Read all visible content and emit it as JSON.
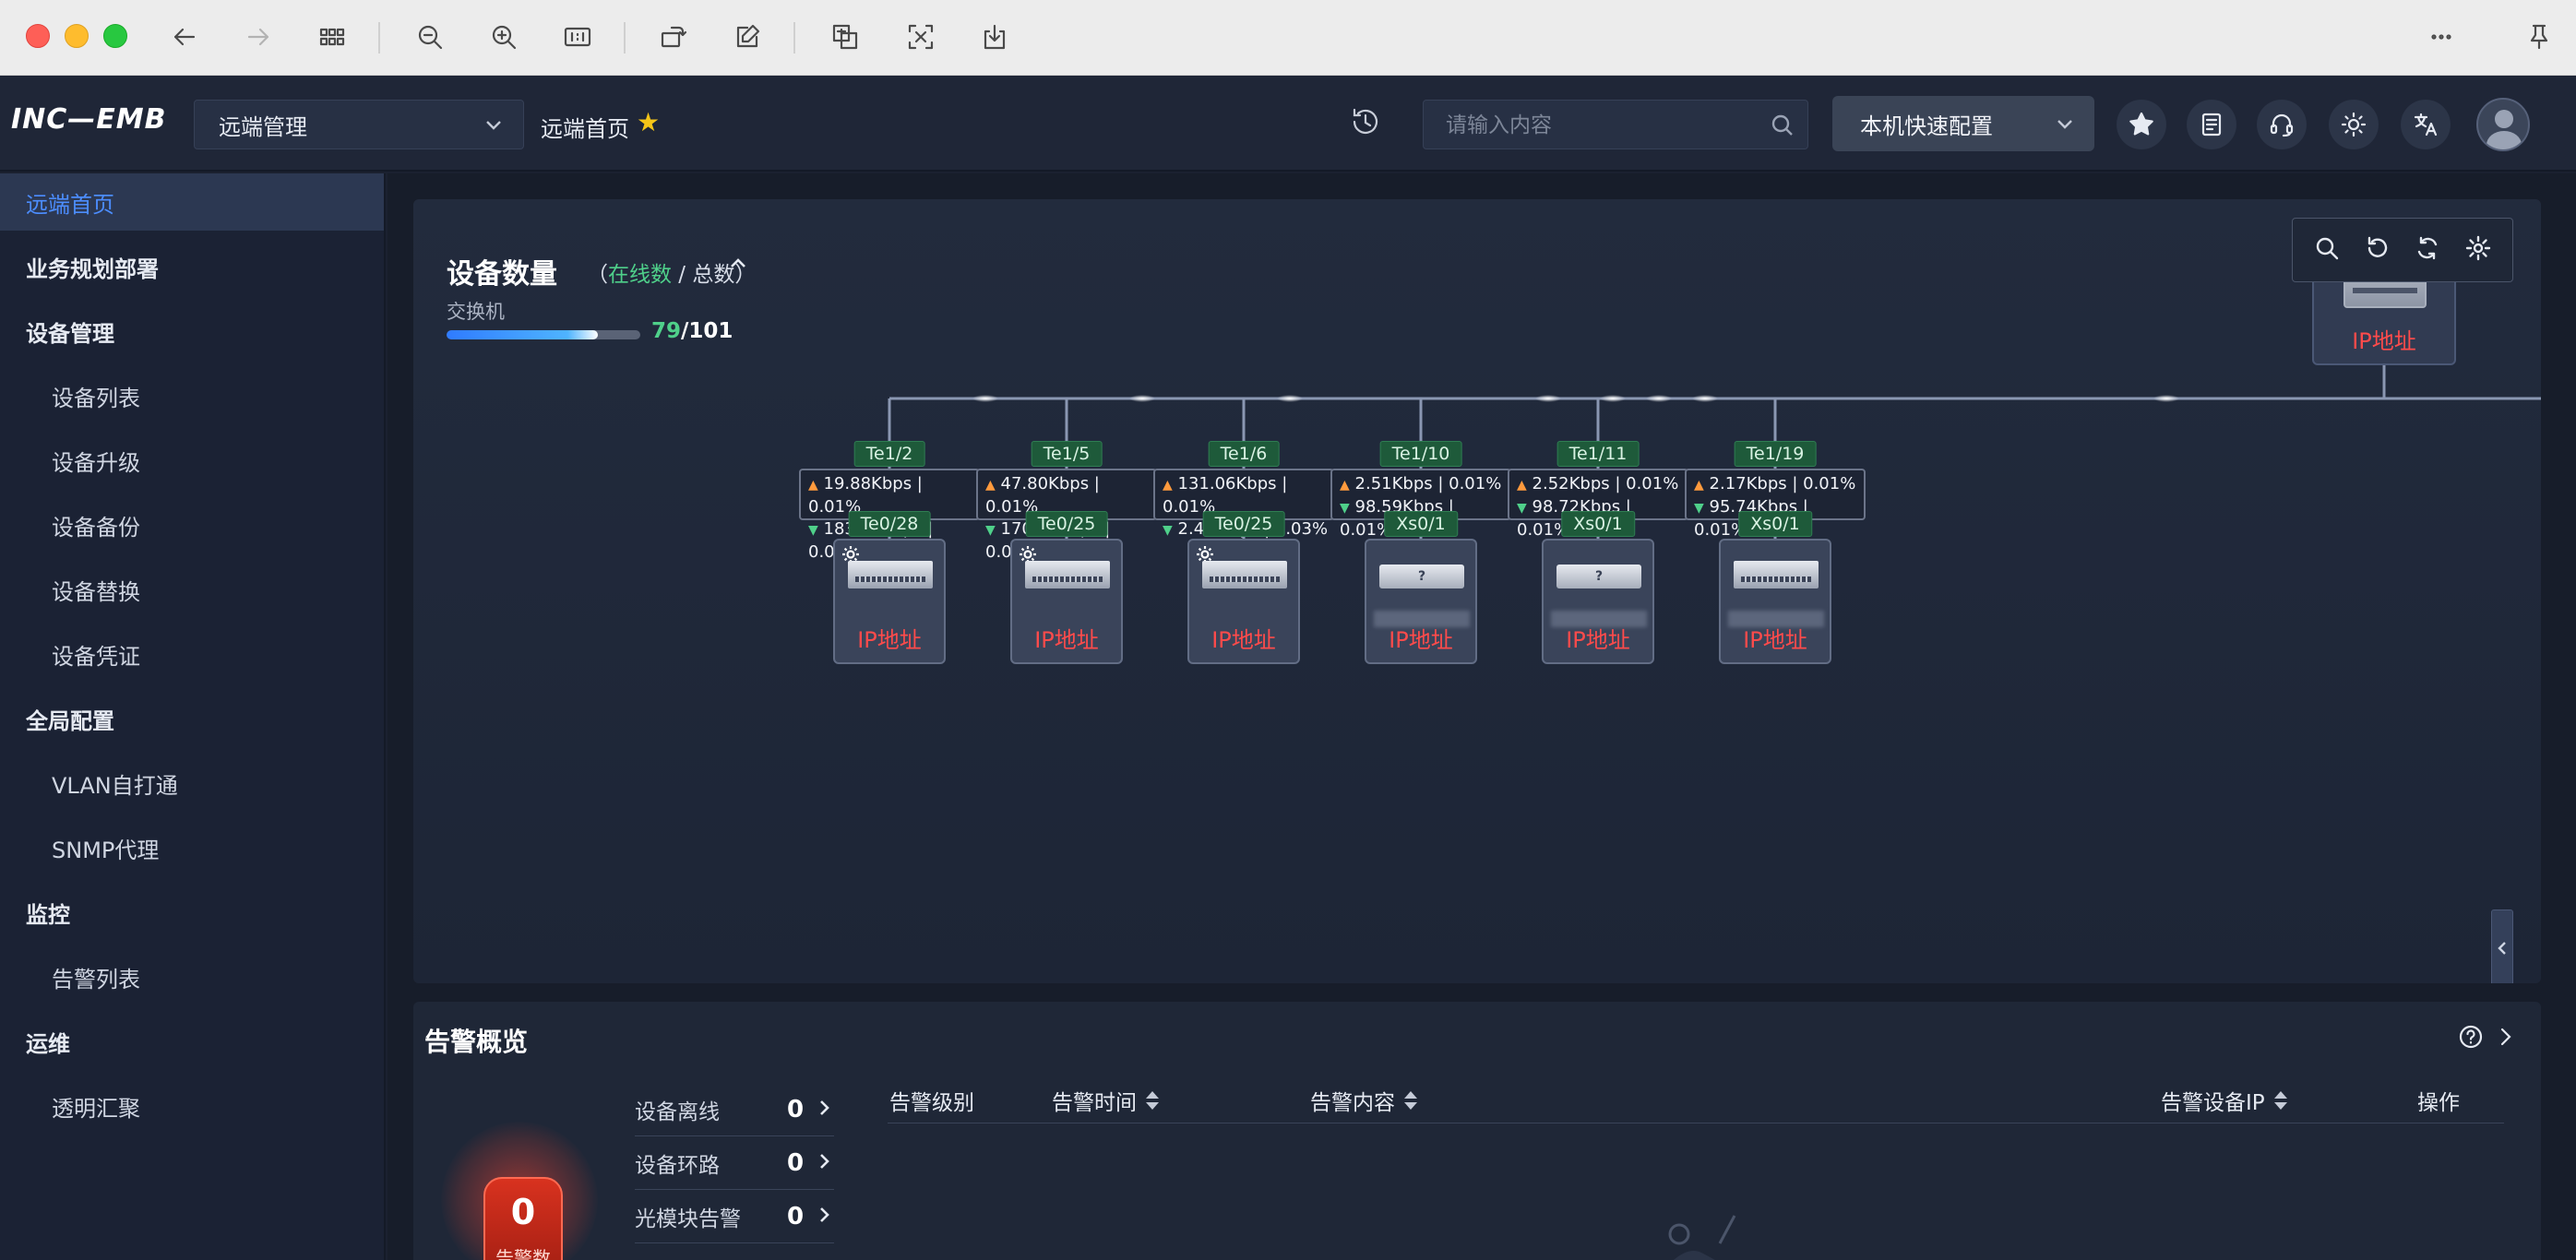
{
  "app": {
    "logo": "INC—EMB"
  },
  "header": {
    "site_select": "远端管理",
    "breadcrumb": "远端首页",
    "search_placeholder": "请输入内容",
    "quick_config": "本机快速配置"
  },
  "sidebar": {
    "items": [
      {
        "label": "远端首页",
        "type": "active"
      },
      {
        "label": "业务规划部署",
        "type": "group"
      },
      {
        "label": "设备管理",
        "type": "group"
      },
      {
        "label": "设备列表",
        "type": "sub"
      },
      {
        "label": "设备升级",
        "type": "sub"
      },
      {
        "label": "设备备份",
        "type": "sub"
      },
      {
        "label": "设备替换",
        "type": "sub"
      },
      {
        "label": "设备凭证",
        "type": "sub"
      },
      {
        "label": "全局配置",
        "type": "group"
      },
      {
        "label": "VLAN自打通",
        "type": "sub"
      },
      {
        "label": "SNMP代理",
        "type": "sub"
      },
      {
        "label": "监控",
        "type": "group"
      },
      {
        "label": "告警列表",
        "type": "sub"
      },
      {
        "label": "运维",
        "type": "group"
      },
      {
        "label": "透明汇聚",
        "type": "sub"
      }
    ]
  },
  "device_count": {
    "title": "设备数量",
    "paren_open": "（",
    "online_label": "在线数",
    "slash_total": " / 总数",
    "paren_close": "）",
    "switch_label": "交换机",
    "online": "79",
    "total": "/101",
    "online_ratio": 0.782
  },
  "topology": {
    "core": {
      "ip": "IP地址"
    },
    "links": [
      {
        "up_port": "Te1/2",
        "up": "19.88Kbps | 0.01%",
        "down": "183.82Kbps | 0.01%",
        "down_port": "Te0/28",
        "device": "switch-config",
        "ip": "IP地址"
      },
      {
        "up_port": "Te1/5",
        "up": "47.80Kbps | 0.01%",
        "down": "170.97Kbps | 0.01%",
        "down_port": "Te0/25",
        "device": "switch-config",
        "ip": "IP地址"
      },
      {
        "up_port": "Te1/6",
        "up": "131.06Kbps | 0.01%",
        "down": "2.45Mbps | 0.03%",
        "down_port": "Te0/25",
        "device": "switch-config",
        "ip": "IP地址"
      },
      {
        "up_port": "Te1/10",
        "up": "2.51Kbps | 0.01%",
        "down": "98.59Kbps | 0.01%",
        "down_port": "Xs0/1",
        "device": "unknown",
        "ip": "IP地址"
      },
      {
        "up_port": "Te1/11",
        "up": "2.52Kbps | 0.01%",
        "down": "98.72Kbps | 0.01%",
        "down_port": "Xs0/1",
        "device": "unknown",
        "ip": "IP地址"
      },
      {
        "up_port": "Te1/19",
        "up": "2.17Kbps | 0.01%",
        "down": "95.74Kbps | 0.01%",
        "down_port": "Xs0/1",
        "device": "switch",
        "ip": "IP地址"
      }
    ]
  },
  "alarm": {
    "title": "告警概览",
    "total": "0",
    "total_caption": "告警数",
    "stats": [
      {
        "label": "设备离线",
        "value": "0"
      },
      {
        "label": "设备环路",
        "value": "0"
      },
      {
        "label": "光模块告警",
        "value": "0"
      }
    ],
    "columns": [
      {
        "label": "告警级别",
        "sortable": false
      },
      {
        "label": "告警时间",
        "sortable": true
      },
      {
        "label": "告警内容",
        "sortable": true
      },
      {
        "label": "告警设备IP",
        "sortable": true
      },
      {
        "label": "操作",
        "sortable": false
      }
    ]
  },
  "colors": {
    "accent": "#4c8dff",
    "online": "#4fd08a",
    "ip_label": "#ff4b4b",
    "alarm": "#d8321f"
  }
}
